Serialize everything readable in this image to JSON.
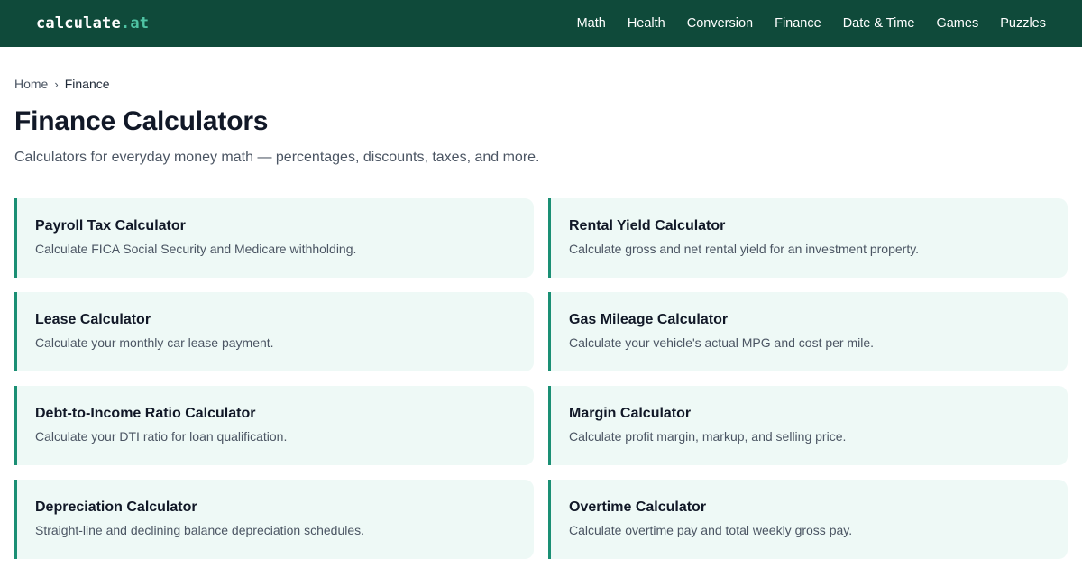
{
  "header": {
    "logo_main": "calculate",
    "logo_tld": ".at",
    "nav": [
      {
        "label": "Math"
      },
      {
        "label": "Health"
      },
      {
        "label": "Conversion"
      },
      {
        "label": "Finance"
      },
      {
        "label": "Date & Time"
      },
      {
        "label": "Games"
      },
      {
        "label": "Puzzles"
      }
    ]
  },
  "breadcrumb": {
    "home": "Home",
    "separator": "›",
    "current": "Finance"
  },
  "page": {
    "title": "Finance Calculators",
    "subtitle": "Calculators for everyday money math — percentages, discounts, taxes, and more."
  },
  "cards": [
    {
      "title": "Payroll Tax Calculator",
      "desc": "Calculate FICA Social Security and Medicare withholding."
    },
    {
      "title": "Rental Yield Calculator",
      "desc": "Calculate gross and net rental yield for an investment property."
    },
    {
      "title": "Lease Calculator",
      "desc": "Calculate your monthly car lease payment."
    },
    {
      "title": "Gas Mileage Calculator",
      "desc": "Calculate your vehicle's actual MPG and cost per mile."
    },
    {
      "title": "Debt-to-Income Ratio Calculator",
      "desc": "Calculate your DTI ratio for loan qualification."
    },
    {
      "title": "Margin Calculator",
      "desc": "Calculate profit margin, markup, and selling price."
    },
    {
      "title": "Depreciation Calculator",
      "desc": "Straight-line and declining balance depreciation schedules."
    },
    {
      "title": "Overtime Calculator",
      "desc": "Calculate overtime pay and total weekly gross pay."
    }
  ],
  "colors": {
    "header_bg": "#0f4a3a",
    "logo_accent": "#4fc4a4",
    "card_bg": "#eef9f6",
    "card_accent": "#1a8f74"
  }
}
